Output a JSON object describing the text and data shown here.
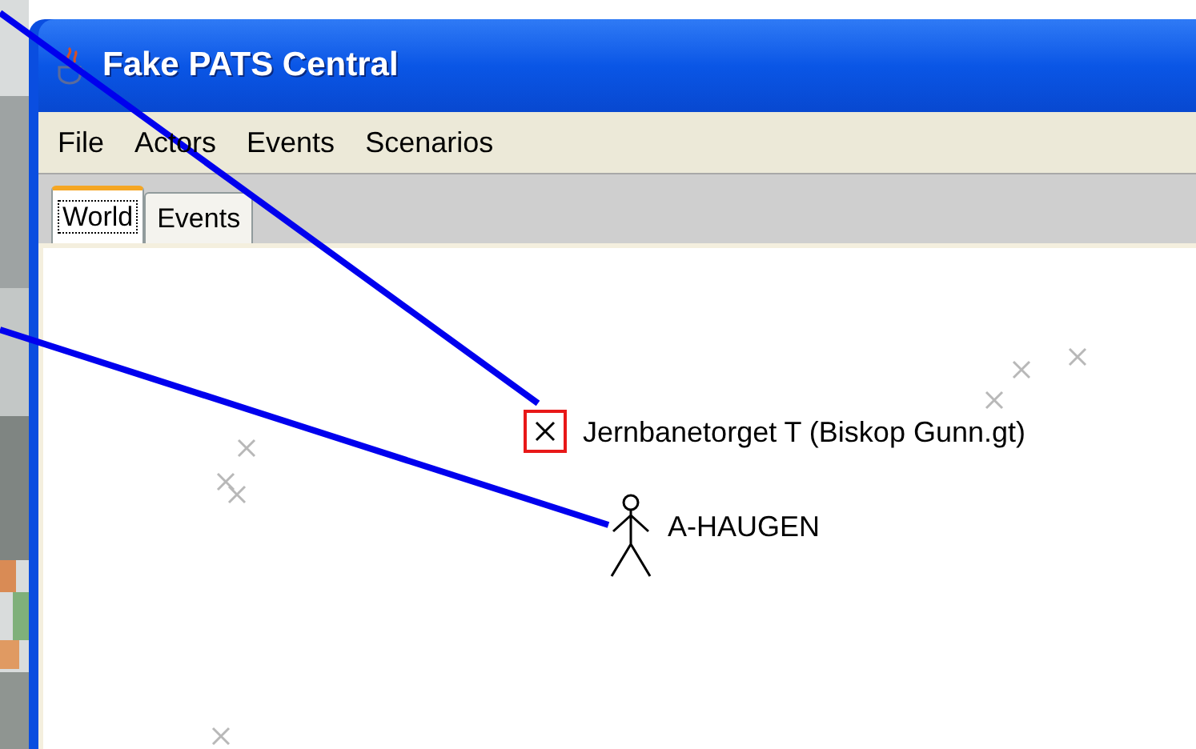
{
  "window": {
    "title": "Fake PATS Central"
  },
  "menu": [
    "File",
    "Actors",
    "Events",
    "Scenarios"
  ],
  "tabs": [
    {
      "label": "World",
      "selected": true
    },
    {
      "label": "Events",
      "selected": false
    }
  ],
  "stations": [
    {
      "label": "Jernbanetorget T (Biskop Gunn.gt)",
      "selected": true
    }
  ],
  "actors": [
    {
      "name": "A-HAUGEN"
    }
  ]
}
